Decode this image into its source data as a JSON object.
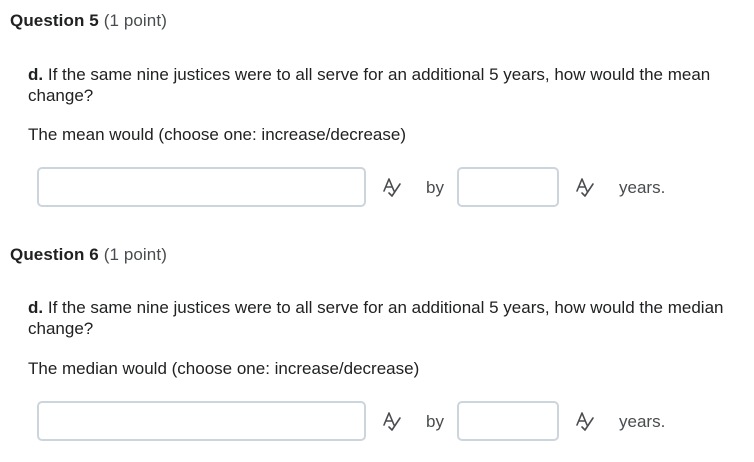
{
  "questions": [
    {
      "number_label": "Question 5",
      "points_label": "(1 point)",
      "prompt_bold": "d.",
      "prompt_text": "If the same nine justices were to all serve for an additional 5 years, how would the mean change?",
      "instruction": "The mean would (choose one:  increase/decrease)",
      "answer1_value": "",
      "by_label": "by",
      "answer2_value": "",
      "unit_label": "years."
    },
    {
      "number_label": "Question 6",
      "points_label": "(1 point)",
      "prompt_bold": "d.",
      "prompt_text": "If the same nine justices were to all serve for an additional 5 years, how would the median change?",
      "instruction": "The median would (choose one:  increase/decrease)",
      "answer1_value": "",
      "by_label": "by",
      "answer2_value": "",
      "unit_label": "years."
    }
  ],
  "icons": {
    "spellcheck": "spellcheck-icon"
  },
  "colors": {
    "input_border": "#cdd5dc",
    "text": "#202122",
    "muted_text": "#494c4e"
  }
}
